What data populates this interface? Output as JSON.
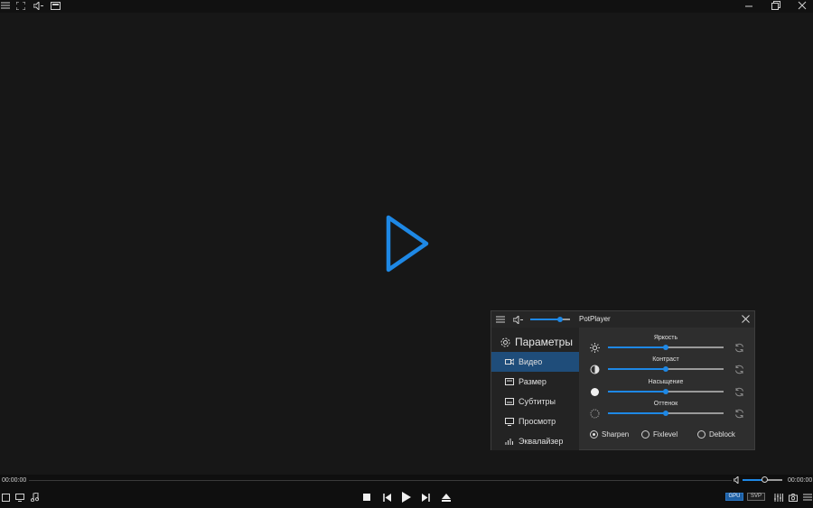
{
  "topbar": {
    "icons": [
      "menu-icon",
      "fullscreen-icon",
      "volume-icon",
      "pip-icon",
      "minimize-icon",
      "restore-icon",
      "close-icon"
    ]
  },
  "center": {
    "icon": "play-icon",
    "accent": "#1e88e5"
  },
  "panel": {
    "title": "PotPlayer",
    "volume_level": 0.75,
    "settings_title": "Параметры",
    "menu": [
      {
        "label": "Видео",
        "icon": "video-camera-icon",
        "active": true
      },
      {
        "label": "Размер",
        "icon": "resize-icon",
        "active": false
      },
      {
        "label": "Субтитры",
        "icon": "subtitles-icon",
        "active": false
      },
      {
        "label": "Просмотр",
        "icon": "monitor-icon",
        "active": false
      },
      {
        "label": "Эквалайзер",
        "icon": "equalizer-icon",
        "active": false
      }
    ],
    "sliders": [
      {
        "label": "Яркость",
        "icon": "brightness-icon",
        "value": 0.5
      },
      {
        "label": "Контраст",
        "icon": "contrast-icon",
        "value": 0.5
      },
      {
        "label": "Насыщение",
        "icon": "saturation-icon",
        "value": 0.5
      },
      {
        "label": "Оттенок",
        "icon": "hue-icon",
        "value": 0.5
      }
    ],
    "options": [
      {
        "label": "Sharpen",
        "checked": true
      },
      {
        "label": "Fixlevel",
        "checked": false
      },
      {
        "label": "Deblock",
        "checked": false
      }
    ]
  },
  "bottom": {
    "time_current": "00:00:00",
    "time_total": "00:00:00",
    "volume_level": 0.55,
    "gpu_label": "GPU",
    "svp_label": "SVP"
  },
  "colors": {
    "accent": "#1e88e5",
    "active_menu": "#1f4d7a",
    "background": "#171717"
  }
}
